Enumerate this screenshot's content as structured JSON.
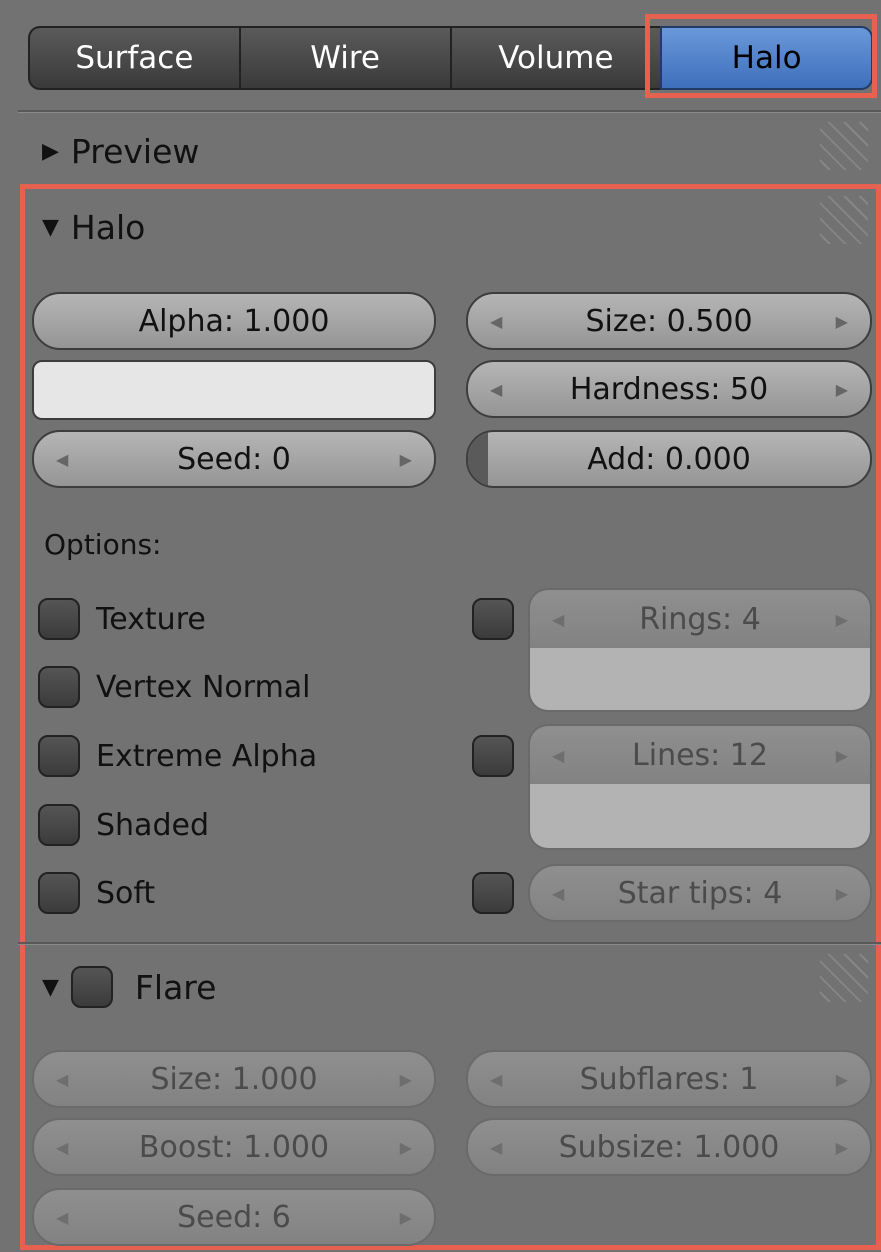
{
  "tabs": {
    "items": [
      "Surface",
      "Wire",
      "Volume",
      "Halo"
    ],
    "active": "Halo"
  },
  "preview": {
    "title": "Preview"
  },
  "halo": {
    "title": "Halo",
    "alpha": "Alpha: 1.000",
    "size": "Size: 0.500",
    "hardness": "Hardness: 50",
    "seed": "Seed: 0",
    "add": "Add: 0.000",
    "add_fraction": 0.0,
    "color_swatch": "#e6e6e6",
    "options_label": "Options:",
    "options": [
      "Texture",
      "Vertex Normal",
      "Extreme Alpha",
      "Shaded",
      "Soft"
    ],
    "rings": "Rings: 4",
    "lines": "Lines: 12",
    "star_tips": "Star tips: 4"
  },
  "flare": {
    "title": "Flare",
    "size": "Size: 1.000",
    "subflares": "Subflares: 1",
    "boost": "Boost: 1.000",
    "subsize": "Subsize: 1.000",
    "seed": "Seed: 6"
  },
  "colors": {
    "accent": "#4a7fcc",
    "highlight": "#e8604f",
    "panel": "#727272"
  }
}
